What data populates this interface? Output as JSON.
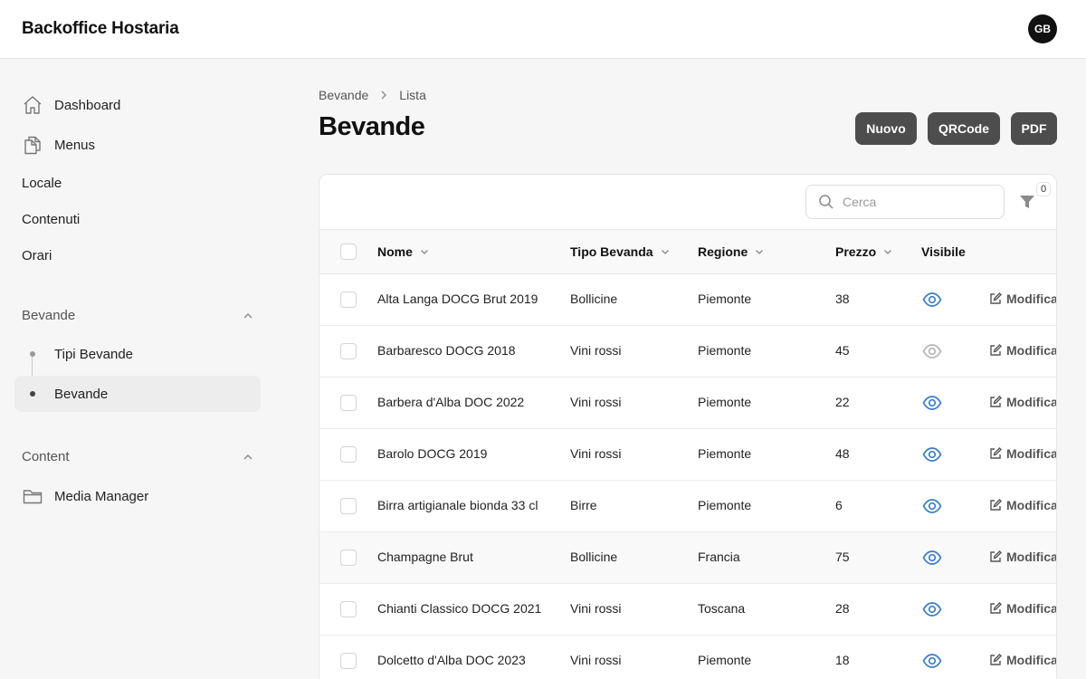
{
  "app": {
    "title": "Backoffice Hostaria",
    "user_initials": "GB"
  },
  "sidebar": {
    "dashboard": "Dashboard",
    "menus": "Menus",
    "locale": "Locale",
    "contenuti": "Contenuti",
    "orari": "Orari",
    "group_bevande": "Bevande",
    "tipi_bevande": "Tipi Bevande",
    "bevande": "Bevande",
    "group_content": "Content",
    "media_manager": "Media Manager"
  },
  "breadcrumb": {
    "parent": "Bevande",
    "current": "Lista"
  },
  "page": {
    "title": "Bevande"
  },
  "actions": {
    "new": "Nuovo",
    "qrcode": "QRCode",
    "pdf": "PDF"
  },
  "search": {
    "placeholder": "Cerca"
  },
  "filter": {
    "count": "0"
  },
  "table": {
    "headers": {
      "name": "Nome",
      "type": "Tipo Bevanda",
      "region": "Regione",
      "price": "Prezzo",
      "visible": "Visibile"
    },
    "edit_label": "Modifica",
    "rows": [
      {
        "name": "Alta Langa DOCG Brut 2019",
        "type": "Bollicine",
        "region": "Piemonte",
        "price": "38",
        "visible": true
      },
      {
        "name": "Barbaresco DOCG 2018",
        "type": "Vini rossi",
        "region": "Piemonte",
        "price": "45",
        "visible": false
      },
      {
        "name": "Barbera d'Alba DOC 2022",
        "type": "Vini rossi",
        "region": "Piemonte",
        "price": "22",
        "visible": true
      },
      {
        "name": "Barolo DOCG 2019",
        "type": "Vini rossi",
        "region": "Piemonte",
        "price": "48",
        "visible": true
      },
      {
        "name": "Birra artigianale bionda 33 cl",
        "type": "Birre",
        "region": "Piemonte",
        "price": "6",
        "visible": true
      },
      {
        "name": "Champagne Brut",
        "type": "Bollicine",
        "region": "Francia",
        "price": "75",
        "visible": true
      },
      {
        "name": "Chianti Classico DOCG 2021",
        "type": "Vini rossi",
        "region": "Toscana",
        "price": "28",
        "visible": true
      },
      {
        "name": "Dolcetto d'Alba DOC 2023",
        "type": "Vini rossi",
        "region": "Piemonte",
        "price": "18",
        "visible": true
      }
    ]
  },
  "colors": {
    "visible_on": "#3b7fc4",
    "visible_off": "#b5b5b5",
    "button_bg": "#4d4d4d"
  }
}
